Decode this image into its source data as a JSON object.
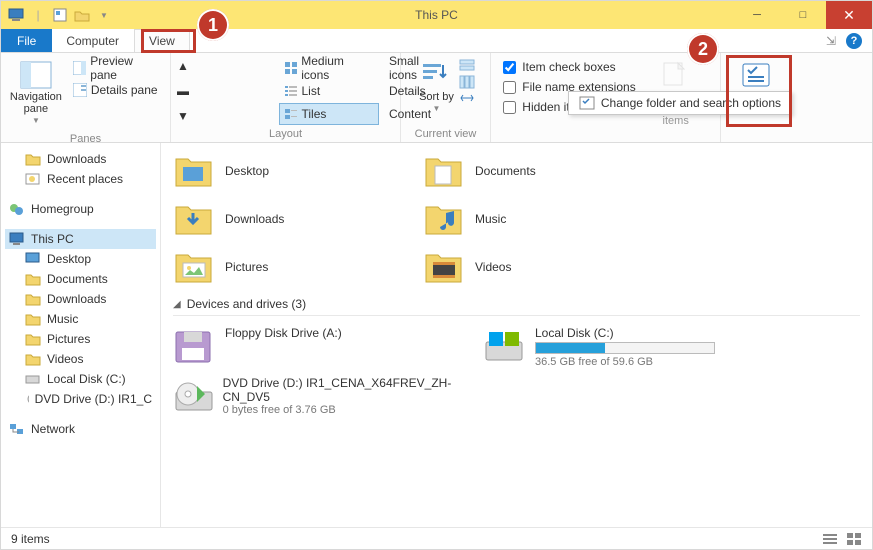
{
  "title": "This PC",
  "tabs": {
    "file": "File",
    "computer": "Computer",
    "view": "View"
  },
  "ribbon": {
    "panes": {
      "nav": "Navigation pane",
      "preview": "Preview pane",
      "details": "Details pane",
      "group": "Panes"
    },
    "layout": {
      "medium": "Medium icons",
      "small": "Small icons",
      "list": "List",
      "details": "Details",
      "tiles": "Tiles",
      "content": "Content",
      "group": "Layout"
    },
    "sort": {
      "label": "Sort by",
      "group": "Current view"
    },
    "show": {
      "checkboxes": "Item check boxes",
      "ext": "File name extensions",
      "hidden": "Hidden items",
      "hide_sel": "Hide selected items"
    },
    "options": {
      "label": "Options",
      "popup": "Change folder and search options"
    }
  },
  "tree": {
    "downloads": "Downloads",
    "recent": "Recent places",
    "homegroup": "Homegroup",
    "thispc": "This PC",
    "desktop": "Desktop",
    "documents": "Documents",
    "music": "Music",
    "pictures": "Pictures",
    "videos": "Videos",
    "localc": "Local Disk (C:)",
    "dvd": "DVD Drive (D:) IR1_C",
    "network": "Network"
  },
  "folders": {
    "desktop": "Desktop",
    "documents": "Documents",
    "downloads": "Downloads",
    "music": "Music",
    "pictures": "Pictures",
    "videos": "Videos"
  },
  "devices_head": "Devices and drives (3)",
  "drives": {
    "floppy": "Floppy Disk Drive (A:)",
    "dvd_name": "DVD Drive (D:) IR1_CENA_X64FREV_ZH-CN_DV5",
    "dvd_sub": "0 bytes free of 3.76 GB",
    "c_name": "Local Disk (C:)",
    "c_sub": "36.5 GB free of 59.6 GB"
  },
  "status": "9 items",
  "callouts": {
    "one": "1",
    "two": "2"
  }
}
